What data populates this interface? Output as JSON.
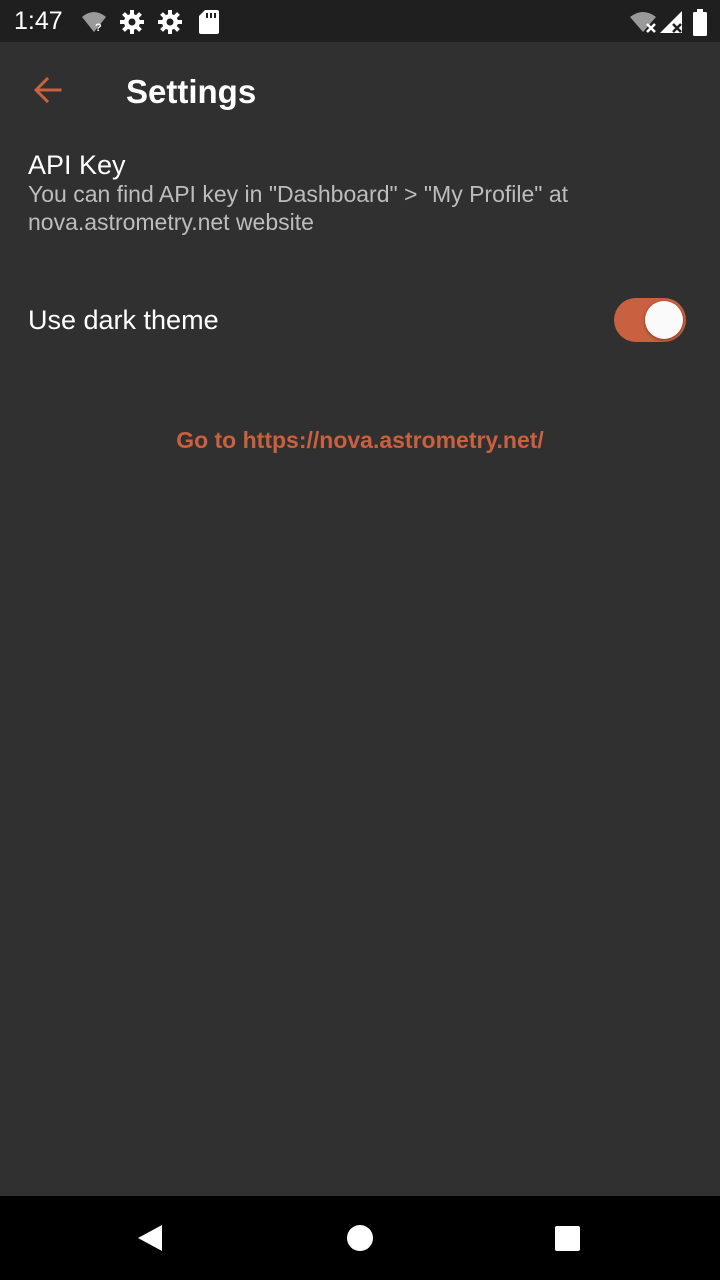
{
  "status_bar": {
    "time": "1:47",
    "icons": [
      "wifi-unknown-icon",
      "gear-icon",
      "gear-icon",
      "sd-card-icon",
      "wifi-off-icon",
      "signal-off-icon",
      "battery-icon"
    ]
  },
  "app_bar": {
    "back_icon": "arrow-back-icon",
    "title": "Settings"
  },
  "preferences": {
    "api_key": {
      "title": "API Key",
      "summary": "You can find API key in \"Dashboard\" > \"My Profile\" at nova.astrometry.net website"
    },
    "dark_theme": {
      "title": "Use dark theme",
      "checked": true
    }
  },
  "link": {
    "text": "Go to https://nova.astrometry.net/"
  },
  "nav_bar": {
    "buttons": [
      "back-triangle-icon",
      "home-circle-icon",
      "recents-square-icon"
    ]
  },
  "colors": {
    "accent": "#c9603f",
    "background": "#303030",
    "status_bar": "#1f1f1f",
    "nav_bar": "#000000"
  }
}
